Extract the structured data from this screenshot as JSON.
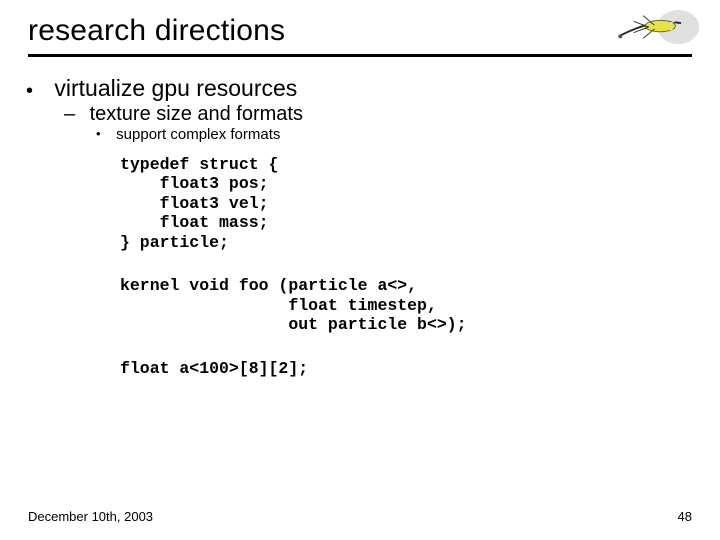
{
  "title": "research directions",
  "bullet1": "virtualize gpu resources",
  "bullet2": "texture size and formats",
  "bullet3": "support complex formats",
  "code1": "typedef struct {\n    float3 pos;\n    float3 vel;\n    float mass;\n} particle;",
  "code2": "kernel void foo (particle a<>,\n                 float timestep,\n                 out particle b<>);",
  "code3": "float a<100>[8][2];",
  "footer_date": "December 10th, 2003",
  "footer_page": "48"
}
